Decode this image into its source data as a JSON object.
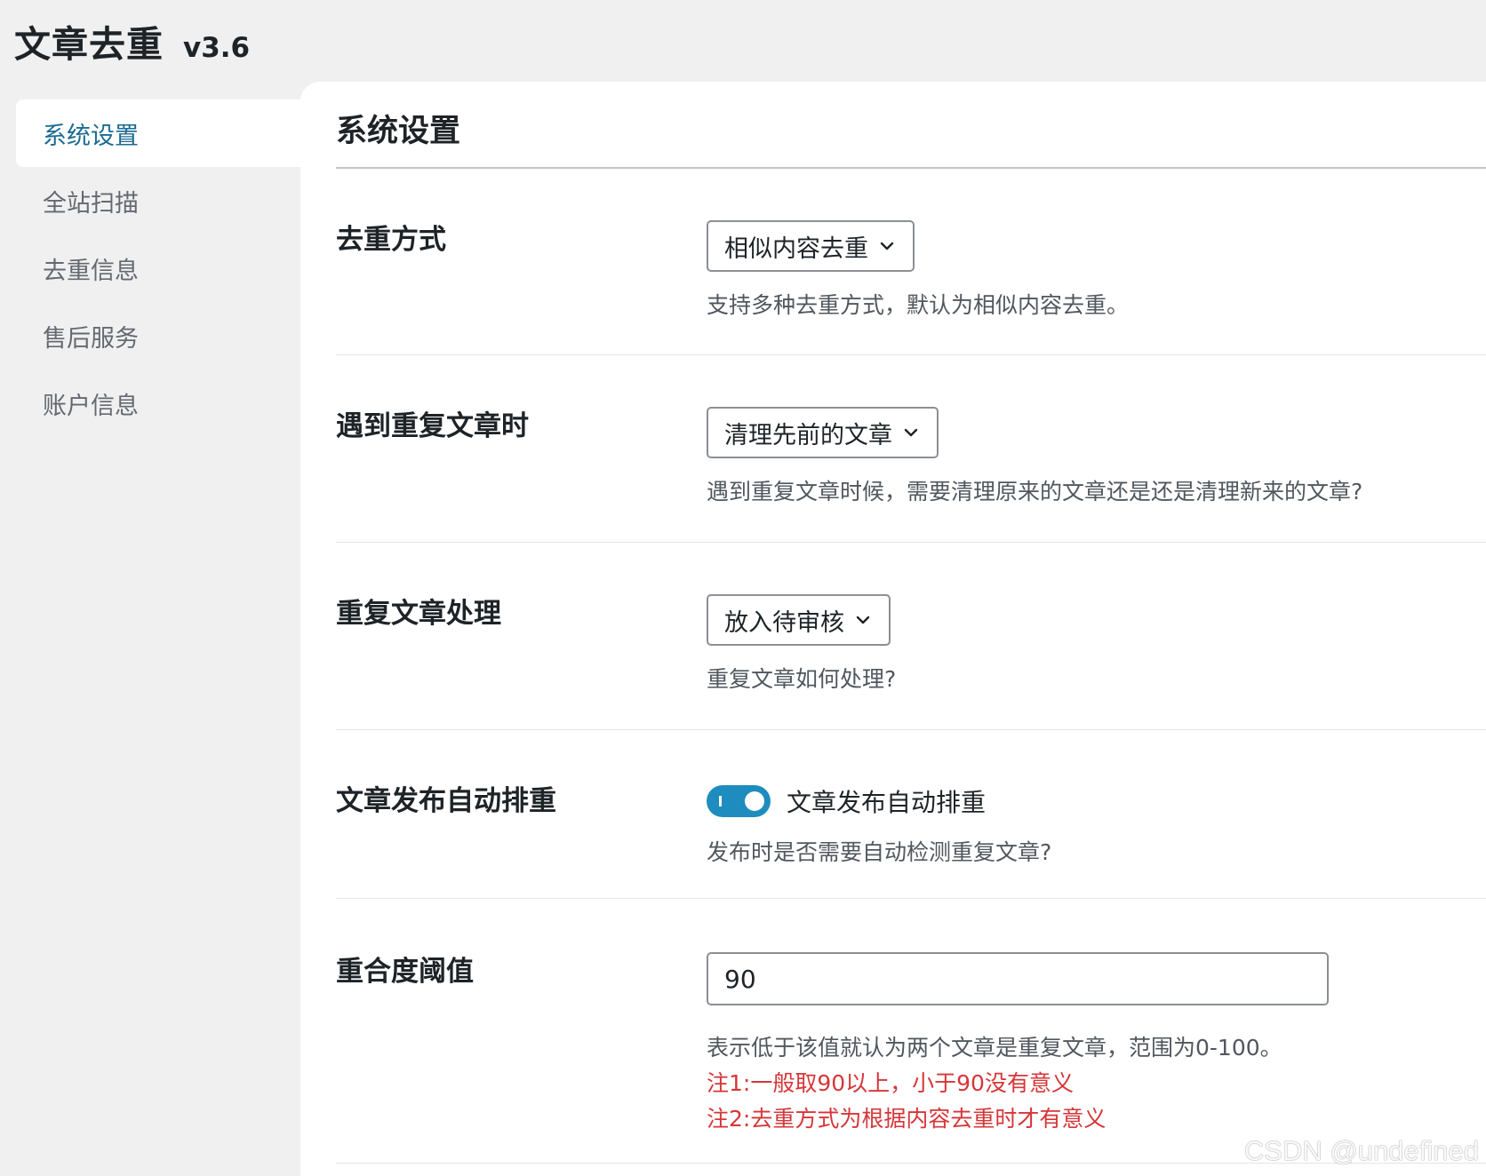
{
  "app": {
    "title": "文章去重",
    "version": "v3.6"
  },
  "sidebar": {
    "items": [
      {
        "label": "系统设置",
        "active": true
      },
      {
        "label": "全站扫描",
        "active": false
      },
      {
        "label": "去重信息",
        "active": false
      },
      {
        "label": "售后服务",
        "active": false
      },
      {
        "label": "账户信息",
        "active": false
      }
    ]
  },
  "page": {
    "title": "系统设置"
  },
  "settings": {
    "dedupe_method": {
      "label": "去重方式",
      "value": "相似内容去重",
      "description": "支持多种去重方式，默认为相似内容去重。"
    },
    "on_duplicate": {
      "label": "遇到重复文章时",
      "value": "清理先前的文章",
      "description": "遇到重复文章时候，需要清理原来的文章还是还是清理新来的文章?"
    },
    "duplicate_handling": {
      "label": "重复文章处理",
      "value": "放入待审核",
      "description": "重复文章如何处理?"
    },
    "auto_dedupe": {
      "label": "文章发布自动排重",
      "toggle_label": "文章发布自动排重",
      "enabled": true,
      "description": "发布时是否需要自动检测重复文章?"
    },
    "threshold": {
      "label": "重合度阈值",
      "value": "90",
      "description": "表示低于该值就认为两个文章是重复文章，范围为0-100。",
      "note1": "注1:一般取90以上，小于90没有意义",
      "note2": "注2:去重方式为根据内容去重时才有意义"
    }
  },
  "watermark": "CSDN @undefined",
  "colors": {
    "accent": "#1e8cbe",
    "active_nav": "#1c6b92",
    "note": "#d63638",
    "background": "#f0f0f1"
  },
  "icons": {
    "select_arrow": "chevron-down-icon"
  }
}
